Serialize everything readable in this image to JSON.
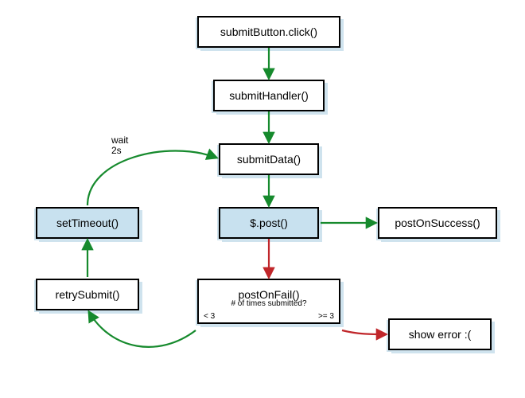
{
  "diagram": {
    "nodes": {
      "submitButtonClick": {
        "label": "submitButton.click()"
      },
      "submitHandler": {
        "label": "submitHandler()"
      },
      "submitData": {
        "label": "submitData()"
      },
      "post": {
        "label": "$.post()"
      },
      "postOnSuccess": {
        "label": "postOnSuccess()"
      },
      "postOnFail": {
        "label": "postOnFail()",
        "sublabel": "# of times submitted?",
        "left": "< 3",
        "right": ">= 3"
      },
      "showError": {
        "label": "show error :("
      },
      "retrySubmit": {
        "label": "retrySubmit()"
      },
      "setTimeout": {
        "label": "setTimeout()"
      }
    },
    "edges": {
      "wait2s": "wait\n2s"
    }
  },
  "chart_data": {
    "type": "flowchart",
    "title": "",
    "nodes": [
      {
        "id": "submitButtonClick",
        "label": "submitButton.click()",
        "highlight": false
      },
      {
        "id": "submitHandler",
        "label": "submitHandler()",
        "highlight": false
      },
      {
        "id": "submitData",
        "label": "submitData()",
        "highlight": false
      },
      {
        "id": "post",
        "label": "$.post()",
        "highlight": true
      },
      {
        "id": "postOnSuccess",
        "label": "postOnSuccess()",
        "highlight": false
      },
      {
        "id": "postOnFail",
        "label": "postOnFail()",
        "sublabel": "# of times submitted?",
        "branch_left": "< 3",
        "branch_right": ">= 3",
        "highlight": false
      },
      {
        "id": "showError",
        "label": "show error :(",
        "highlight": false
      },
      {
        "id": "retrySubmit",
        "label": "retrySubmit()",
        "highlight": false
      },
      {
        "id": "setTimeout",
        "label": "setTimeout()",
        "highlight": true
      }
    ],
    "edges": [
      {
        "from": "submitButtonClick",
        "to": "submitHandler",
        "color": "green"
      },
      {
        "from": "submitHandler",
        "to": "submitData",
        "color": "green"
      },
      {
        "from": "submitData",
        "to": "post",
        "color": "green"
      },
      {
        "from": "post",
        "to": "postOnSuccess",
        "color": "green"
      },
      {
        "from": "post",
        "to": "postOnFail",
        "color": "red"
      },
      {
        "from": "postOnFail",
        "to": "showError",
        "color": "red",
        "condition": ">= 3"
      },
      {
        "from": "postOnFail",
        "to": "retrySubmit",
        "color": "green",
        "condition": "< 3"
      },
      {
        "from": "retrySubmit",
        "to": "setTimeout",
        "color": "green"
      },
      {
        "from": "setTimeout",
        "to": "submitData",
        "color": "green",
        "label": "wait 2s"
      }
    ]
  }
}
